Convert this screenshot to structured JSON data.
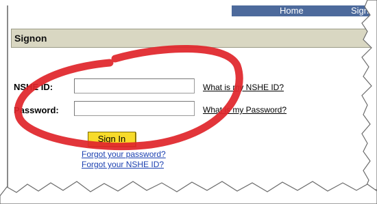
{
  "nav": {
    "home": "Home",
    "sign": "Sign"
  },
  "panel": {
    "title": "Signon"
  },
  "form": {
    "nshe_label": "NSHE ID:",
    "password_label": "Password:",
    "nshe_value": "",
    "password_value": "",
    "nshe_help": "What is my NSHE ID?",
    "password_help": "What is my Password?",
    "signin_label": "Sign In",
    "forgot_password": "Forgot your password?",
    "forgot_nshe": "Forgot your NSHE ID?"
  },
  "colors": {
    "nav_bg": "#4d6a9c",
    "title_bg": "#d9d7c2",
    "button_bg": "#f7db2a",
    "link": "#1a3fb0",
    "annotation": "#e0262b"
  }
}
